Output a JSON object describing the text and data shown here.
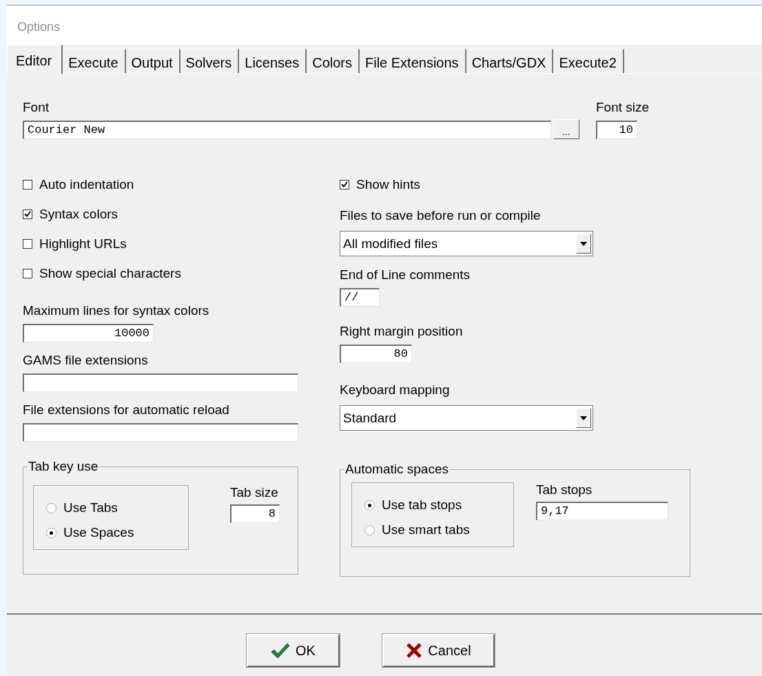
{
  "window": {
    "title": "Options"
  },
  "tabs": [
    {
      "label": "Editor",
      "selected": true
    },
    {
      "label": "Execute",
      "selected": false
    },
    {
      "label": "Output",
      "selected": false
    },
    {
      "label": "Solvers",
      "selected": false
    },
    {
      "label": "Licenses",
      "selected": false
    },
    {
      "label": "Colors",
      "selected": false
    },
    {
      "label": "File Extensions",
      "selected": false
    },
    {
      "label": "Charts/GDX",
      "selected": false
    },
    {
      "label": "Execute2",
      "selected": false
    }
  ],
  "font": {
    "label": "Font",
    "value": "Courier New",
    "browse_button": "..."
  },
  "font_size": {
    "label": "Font size",
    "value": "10"
  },
  "left_options": [
    {
      "kind": "checkbox",
      "label": "Auto indentation",
      "checked": false
    },
    {
      "kind": "checkbox",
      "label": "Syntax colors",
      "checked": true
    },
    {
      "kind": "checkbox",
      "label": "Highlight URLs",
      "checked": false
    },
    {
      "kind": "checkbox",
      "label": "Show special characters",
      "checked": false
    },
    {
      "kind": "number",
      "label": "Maximum lines for syntax colors",
      "value": "10000"
    },
    {
      "kind": "text",
      "label": "GAMS file extensions"
    },
    {
      "kind": "text",
      "label": "File extensions for automatic reload"
    }
  ],
  "right_options": [
    {
      "kind": "checkbox",
      "label": "Show hints",
      "checked": true
    },
    {
      "kind": "select",
      "label": "Files to save before run or compile",
      "value": "All modified files"
    },
    {
      "kind": "text",
      "label": "End of Line comments",
      "value": "//"
    },
    {
      "kind": "number",
      "label": "Right margin position",
      "value": "80"
    },
    {
      "kind": "select",
      "label": "Keyboard mapping",
      "value": "Standard"
    }
  ],
  "tab_key_use": {
    "title": "Tab key use",
    "options": [
      {
        "label": "Use Tabs",
        "selected": false
      },
      {
        "label": "Use Spaces",
        "selected": true
      }
    ],
    "field": {
      "kind": "number",
      "label": "Tab size",
      "value": "8"
    }
  },
  "automatic_spaces": {
    "title": "Automatic spaces",
    "options": [
      {
        "label": "Use tab stops",
        "selected": true
      },
      {
        "label": "Use smart tabs",
        "selected": false
      }
    ],
    "field": {
      "kind": "text",
      "label": "Tab stops",
      "value": "9,17"
    }
  },
  "buttons": [
    {
      "kind": "ok",
      "label": "OK"
    },
    {
      "kind": "cancel",
      "label": "Cancel"
    }
  ]
}
